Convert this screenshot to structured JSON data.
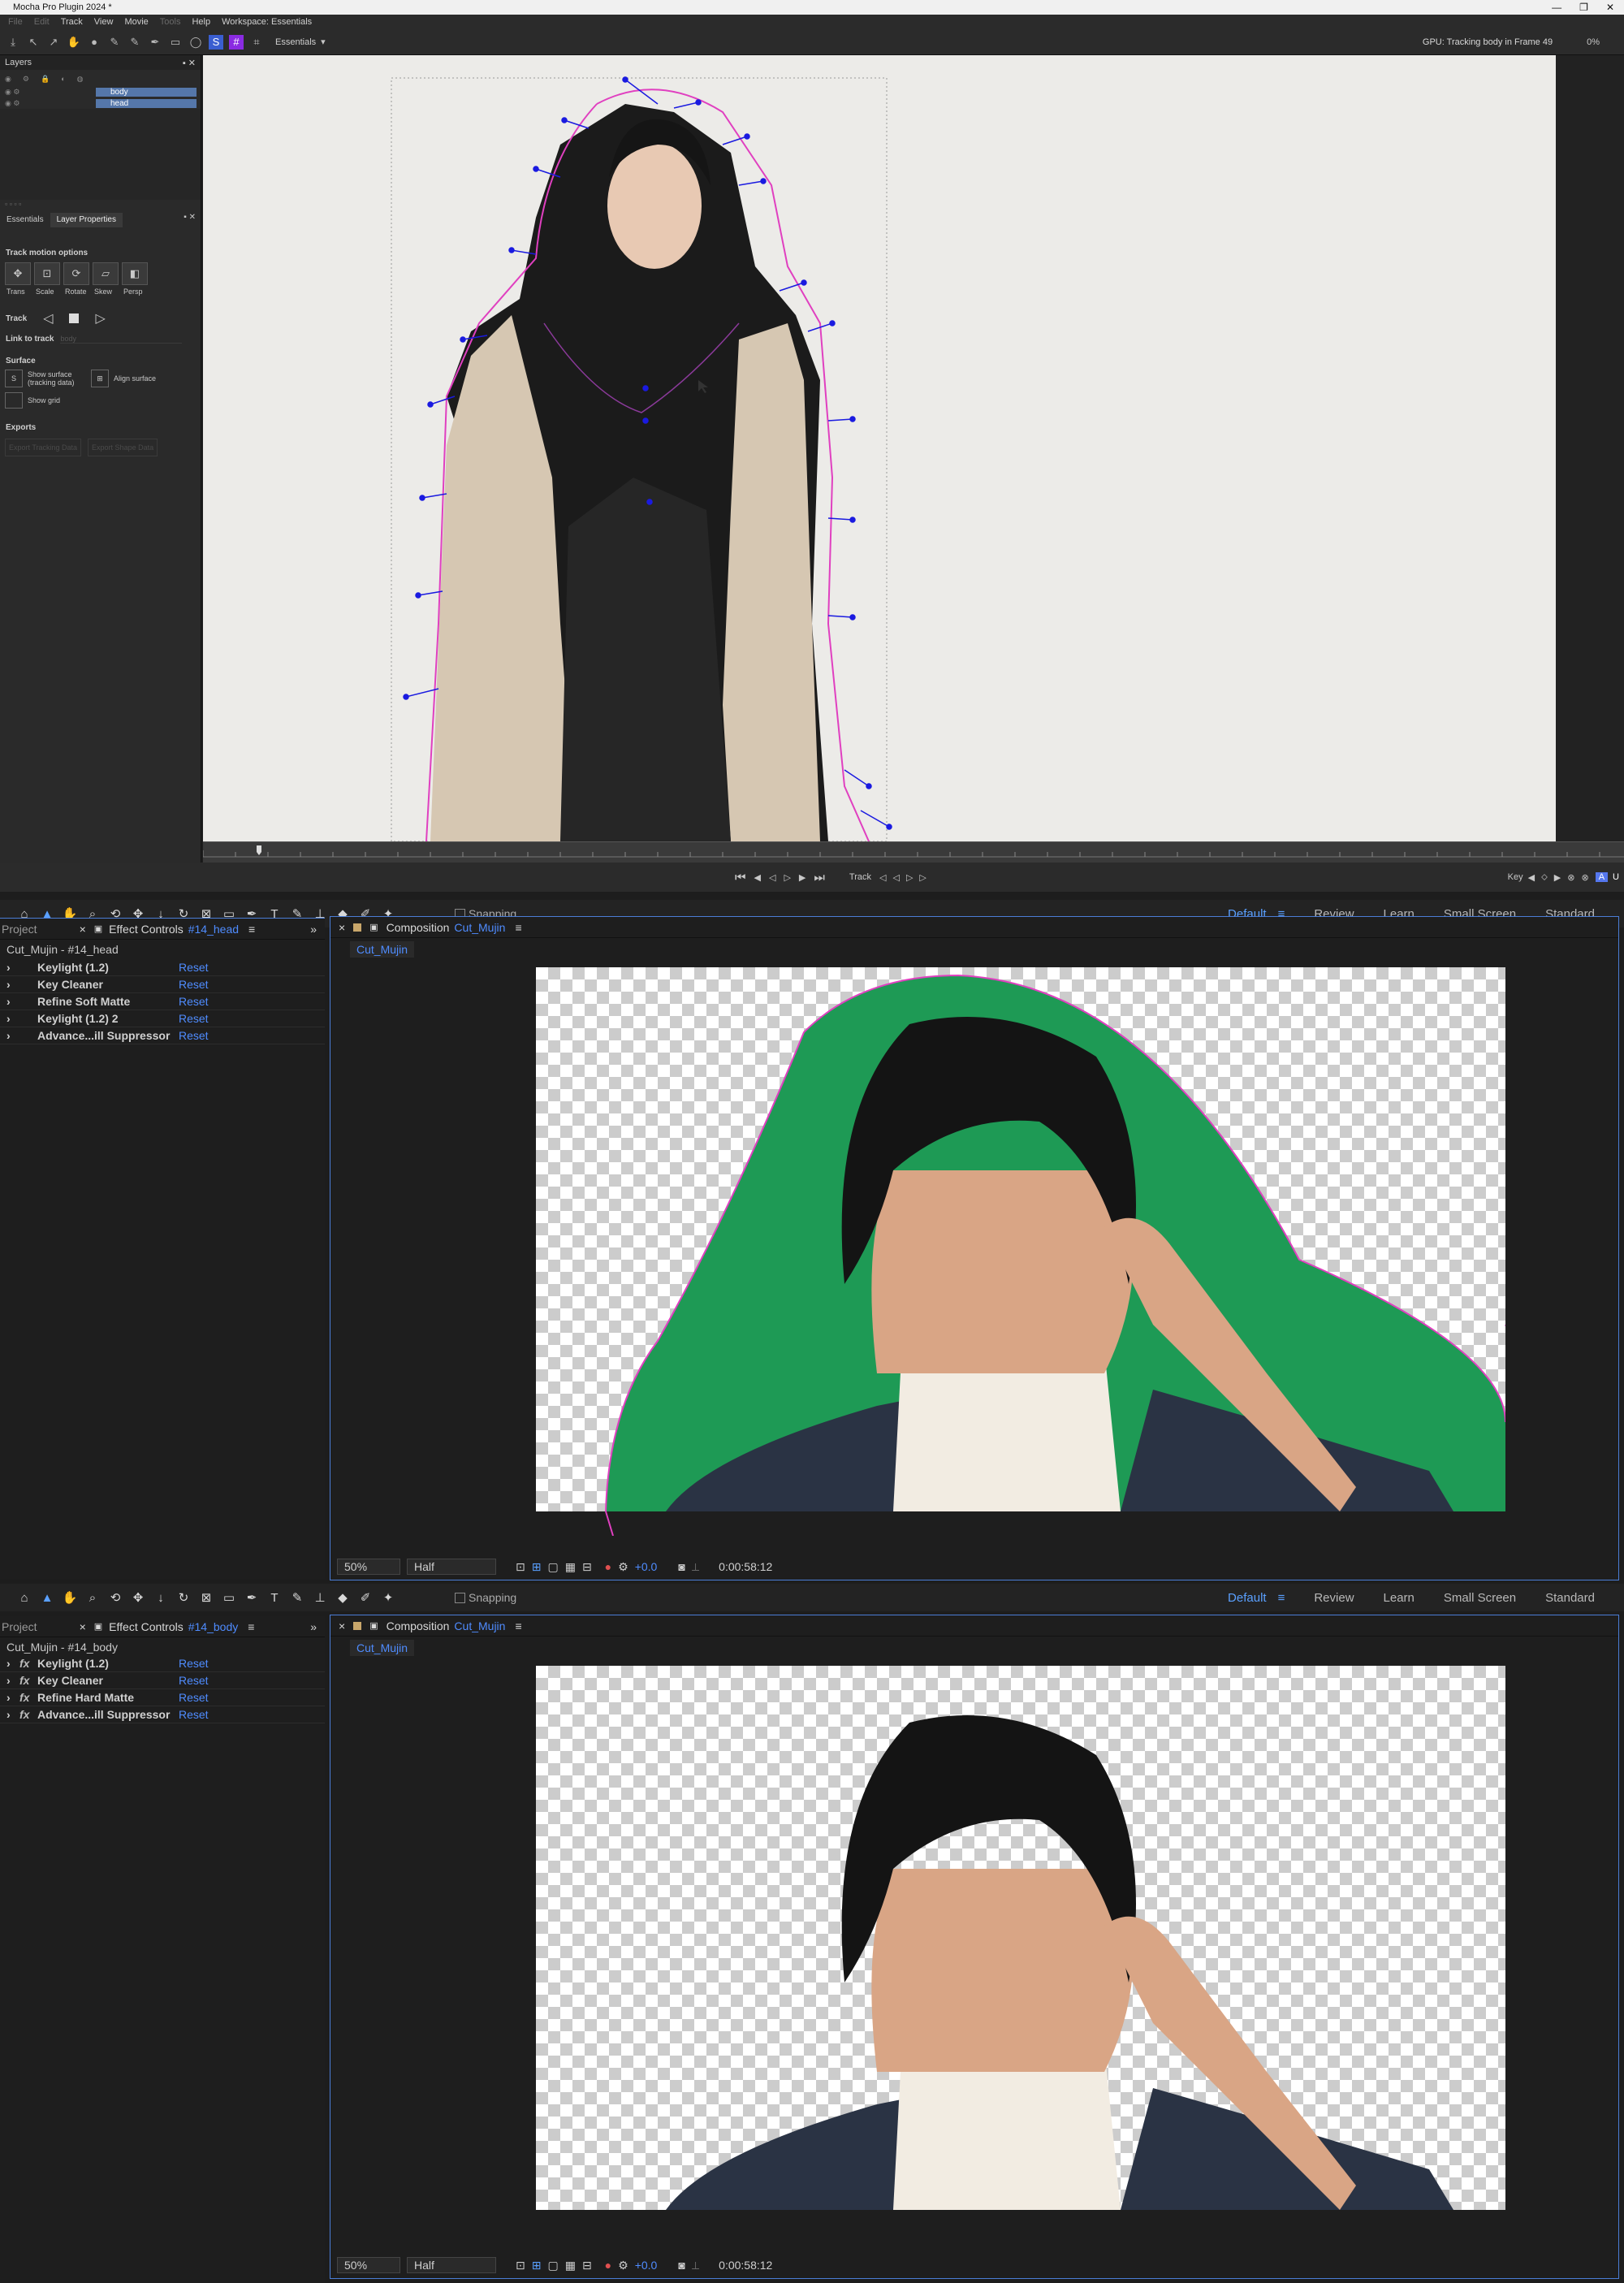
{
  "mocha": {
    "title": "Mocha Pro Plugin 2024 *",
    "menu": [
      "File",
      "Edit",
      "Track",
      "View",
      "Movie",
      "Tools",
      "Help",
      "Workspace: Essentials"
    ],
    "workspace": "Essentials",
    "status": "GPU: Tracking body in Frame 49",
    "percent": "0%",
    "layers_title": "Layers",
    "layers": [
      "body",
      "head"
    ],
    "tabs": [
      "Essentials",
      "Layer Properties"
    ],
    "track_motion_options": "Track motion options",
    "motion_opts": [
      "Trans",
      "Scale",
      "Rotate",
      "Skew",
      "Persp"
    ],
    "track_label": "Track",
    "link_to_track": "Link to track",
    "link_value": "body",
    "surface": "Surface",
    "show_surface": "Show surface (tracking data)",
    "align_surface": "Align surface",
    "show_grid": "Show grid",
    "exports": "Exports",
    "export_buttons": [
      "Export Tracking Data",
      "Export Shape Data"
    ],
    "transport_track": "Track",
    "transport_key": "Key"
  },
  "ae_top": {
    "workspaces": [
      "Default",
      "Review",
      "Learn",
      "Small Screen",
      "Standard"
    ],
    "project_tab": "Project",
    "effect_controls_tab": "Effect Controls",
    "effect_layer": "#14_head",
    "comp_label": "Cut_Mujin - #14_head",
    "effects": [
      {
        "name": "Keylight (1.2)",
        "reset": "Reset"
      },
      {
        "name": "Key Cleaner",
        "reset": "Reset"
      },
      {
        "name": "Refine Soft Matte",
        "reset": "Reset"
      },
      {
        "name": "Keylight (1.2) 2",
        "reset": "Reset"
      },
      {
        "name": "Advance...ill Suppressor",
        "reset": "Reset"
      }
    ],
    "composition_tab": "Composition",
    "composition_name": "Cut_Mujin",
    "comp_subtab": "Cut_Mujin",
    "zoom": "50%",
    "resolution": "Half",
    "exposure": "+0.0",
    "timecode": "0:00:58:12",
    "snapping": "Snapping"
  },
  "ae_bottom": {
    "workspaces": [
      "Default",
      "Review",
      "Learn",
      "Small Screen",
      "Standard"
    ],
    "project_tab": "Project",
    "effect_controls_tab": "Effect Controls",
    "effect_layer": "#14_body",
    "comp_label": "Cut_Mujin - #14_body",
    "effects": [
      {
        "name": "Keylight (1.2)",
        "reset": "Reset"
      },
      {
        "name": "Key Cleaner",
        "reset": "Reset"
      },
      {
        "name": "Refine Hard Matte",
        "reset": "Reset"
      },
      {
        "name": "Advance...ill Suppressor",
        "reset": "Reset"
      }
    ],
    "composition_tab": "Composition",
    "composition_name": "Cut_Mujin",
    "comp_subtab": "Cut_Mujin",
    "zoom": "50%",
    "resolution": "Half",
    "exposure": "+0.0",
    "timecode": "0:00:58:12",
    "snapping": "Snapping"
  },
  "colors": {
    "accent": "#4f8cff",
    "green_screen": "#1e9a55",
    "spline": "#e040c0",
    "track_points": "#1a1ae0"
  }
}
